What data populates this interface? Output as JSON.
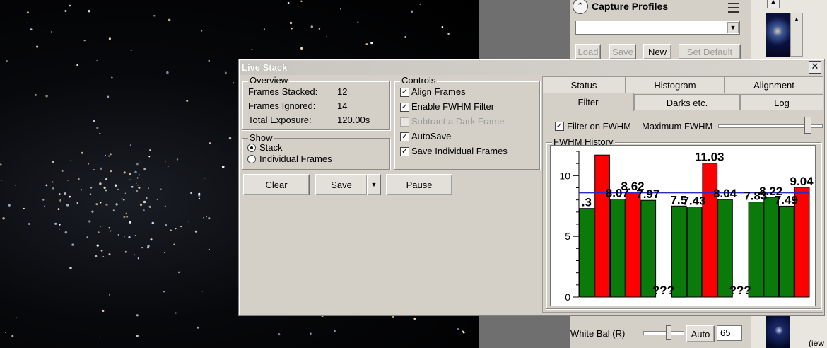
{
  "capture_profiles": {
    "title": "Capture Profiles",
    "dropdown_value": "",
    "load_label": "Load",
    "save_label": "Save",
    "new_label": "New",
    "set_default_label": "Set Default"
  },
  "white_bal": {
    "label": "White Bal (R)",
    "auto_label": "Auto",
    "value": "65"
  },
  "far_right": {
    "partial_text": "(iew"
  },
  "live_stack": {
    "title": "Live Stack",
    "close_label": "✕",
    "overview": {
      "label": "Overview",
      "rows": [
        {
          "label": "Frames Stacked:",
          "value": "12"
        },
        {
          "label": "Frames Ignored:",
          "value": "14"
        },
        {
          "label": "Total Exposure:",
          "value": "120.00s"
        }
      ]
    },
    "show": {
      "label": "Show",
      "options": [
        {
          "label": "Stack",
          "selected": true
        },
        {
          "label": "Individual Frames",
          "selected": false
        }
      ]
    },
    "controls": {
      "label": "Controls",
      "items": [
        {
          "label": "Align Frames",
          "checked": true,
          "enabled": true
        },
        {
          "label": "Enable FWHM Filter",
          "checked": true,
          "enabled": true
        },
        {
          "label": "Subtract a Dark Frame",
          "checked": false,
          "enabled": false
        },
        {
          "label": "AutoSave",
          "checked": true,
          "enabled": true
        },
        {
          "label": "Save Individual Frames",
          "checked": true,
          "enabled": true
        }
      ]
    },
    "buttons": {
      "clear": "Clear",
      "save": "Save",
      "pause": "Pause"
    },
    "tabs_row1": [
      "Status",
      "Histogram",
      "Alignment"
    ],
    "tabs_row2": [
      "Filter",
      "Darks etc.",
      "Log"
    ],
    "active_tab": "Filter",
    "filter": {
      "filter_on_fwhm_label": "Filter on FWHM",
      "filter_on_fwhm_checked": true,
      "max_fwhm_label": "Maximum FWHM",
      "max_fwhm_slider_fraction": 0.9,
      "history_label": "FWHM History"
    }
  },
  "chart_data": {
    "type": "bar",
    "ylim": [
      0,
      12
    ],
    "yticks": [
      "0",
      "5",
      "10"
    ],
    "threshold": 8.6,
    "threshold_color": "#2b2bcc",
    "bars": [
      {
        "value": 7.3,
        "color": "#0a7a0a",
        "label": ".3"
      },
      {
        "value": 11.7,
        "color": "#ff0000",
        "label": ""
      },
      {
        "value": 8.07,
        "color": "#0a7a0a",
        "label": "8.07"
      },
      {
        "value": 8.62,
        "color": "#ff0000",
        "label": "8.62"
      },
      {
        "value": 7.97,
        "color": "#0a7a0a",
        "label": "7.97"
      },
      {
        "value": 0,
        "color": "#0a7a0a",
        "label": "???"
      },
      {
        "value": 7.5,
        "color": "#0a7a0a",
        "label": "7.5"
      },
      {
        "value": 7.43,
        "color": "#0a7a0a",
        "label": "7.43"
      },
      {
        "value": 11.03,
        "color": "#ff0000",
        "label": "11.03"
      },
      {
        "value": 8.04,
        "color": "#0a7a0a",
        "label": "8.04"
      },
      {
        "value": 0,
        "color": "#0a7a0a",
        "label": "???"
      },
      {
        "value": 7.83,
        "color": "#0a7a0a",
        "label": "7.83"
      },
      {
        "value": 8.22,
        "color": "#0a7a0a",
        "label": "8.22"
      },
      {
        "value": 7.49,
        "color": "#0a7a0a",
        "label": "7.49"
      },
      {
        "value": 9.04,
        "color": "#ff0000",
        "label": "9.04"
      }
    ]
  }
}
